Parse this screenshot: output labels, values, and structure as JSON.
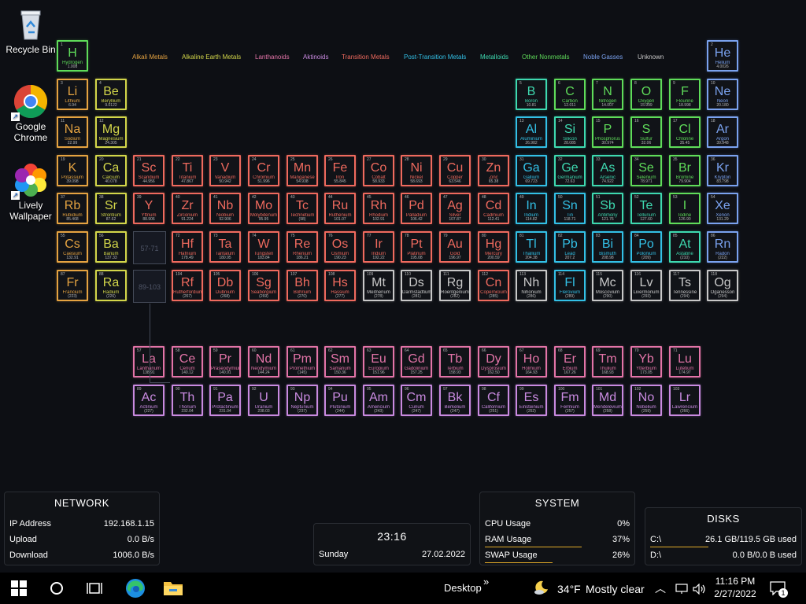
{
  "desktop": {
    "icons": [
      {
        "label": "Recycle Bin",
        "icon": "recycle-bin-icon"
      },
      {
        "label": "Google Chrome",
        "icon": "chrome-icon"
      },
      {
        "label": "Lively Wallpaper",
        "icon": "lively-wallpaper-icon"
      }
    ]
  },
  "legend": [
    {
      "label": "Alkali Metals",
      "color": "#e5a341"
    },
    {
      "label": "Alkaline Earth Metals",
      "color": "#d3d64a"
    },
    {
      "label": "Lanthanoids",
      "color": "#e374a8"
    },
    {
      "label": "Aktinoids",
      "color": "#c98ae0"
    },
    {
      "label": "Transition Metals",
      "color": "#ef6a5e"
    },
    {
      "label": "Post-Transition Metals",
      "color": "#33c0e6"
    },
    {
      "label": "Metalloids",
      "color": "#3ed9b0"
    },
    {
      "label": "Other Nonmetals",
      "color": "#5fdc5a"
    },
    {
      "label": "Noble Gasses",
      "color": "#7aa2ef"
    },
    {
      "label": "Unknown",
      "color": "#c8c8c8"
    }
  ],
  "placeholders": {
    "lanthanoids": "57-71",
    "actinoids": "89-103"
  },
  "elements": [
    {
      "n": "1",
      "s": "H",
      "name": "Hydrogen",
      "m": "1.008",
      "c": "nonmetal"
    },
    {
      "n": "2",
      "s": "He",
      "name": "Helium",
      "m": "4.0026",
      "c": "noble"
    },
    {
      "n": "3",
      "s": "Li",
      "name": "Lithium",
      "m": "6.94",
      "c": "alkali"
    },
    {
      "n": "4",
      "s": "Be",
      "name": "Beryllium",
      "m": "9.0122",
      "c": "alkaline"
    },
    {
      "n": "5",
      "s": "B",
      "name": "Boron",
      "m": "10.81",
      "c": "metalloid"
    },
    {
      "n": "6",
      "s": "C",
      "name": "Carbon",
      "m": "12.011",
      "c": "nonmetal"
    },
    {
      "n": "7",
      "s": "N",
      "name": "Nitrogen",
      "m": "14.007",
      "c": "nonmetal"
    },
    {
      "n": "8",
      "s": "O",
      "name": "Oxygen",
      "m": "15.999",
      "c": "nonmetal"
    },
    {
      "n": "9",
      "s": "F",
      "name": "Flourine",
      "m": "18.998",
      "c": "nonmetal"
    },
    {
      "n": "10",
      "s": "Ne",
      "name": "Neon",
      "m": "20.180",
      "c": "noble"
    },
    {
      "n": "11",
      "s": "Na",
      "name": "Sodium",
      "m": "22.99",
      "c": "alkali"
    },
    {
      "n": "12",
      "s": "Mg",
      "name": "Magnesium",
      "m": "24.305",
      "c": "alkaline"
    },
    {
      "n": "13",
      "s": "Al",
      "name": "Aluminium",
      "m": "26.982",
      "c": "post"
    },
    {
      "n": "14",
      "s": "Si",
      "name": "Silicon",
      "m": "28.085",
      "c": "metalloid"
    },
    {
      "n": "15",
      "s": "P",
      "name": "Phosphorus",
      "m": "30.974",
      "c": "nonmetal"
    },
    {
      "n": "16",
      "s": "S",
      "name": "Sulfur",
      "m": "32.06",
      "c": "nonmetal"
    },
    {
      "n": "17",
      "s": "Cl",
      "name": "Chlorine",
      "m": "35.45",
      "c": "nonmetal"
    },
    {
      "n": "18",
      "s": "Ar",
      "name": "Argon",
      "m": "39.948",
      "c": "noble"
    },
    {
      "n": "19",
      "s": "K",
      "name": "Potassium",
      "m": "39.098",
      "c": "alkali"
    },
    {
      "n": "20",
      "s": "Ca",
      "name": "Calcium",
      "m": "40.078",
      "c": "alkaline"
    },
    {
      "n": "21",
      "s": "Sc",
      "name": "Scandium",
      "m": "44.956",
      "c": "transition"
    },
    {
      "n": "22",
      "s": "Ti",
      "name": "Titanium",
      "m": "47.867",
      "c": "transition"
    },
    {
      "n": "23",
      "s": "V",
      "name": "Vanadium",
      "m": "50.942",
      "c": "transition"
    },
    {
      "n": "24",
      "s": "Cr",
      "name": "Chromium",
      "m": "51.996",
      "c": "transition"
    },
    {
      "n": "25",
      "s": "Mn",
      "name": "Manganese",
      "m": "54.938",
      "c": "transition"
    },
    {
      "n": "26",
      "s": "Fe",
      "name": "Iron",
      "m": "55.845",
      "c": "transition"
    },
    {
      "n": "27",
      "s": "Co",
      "name": "Cobalt",
      "m": "58.933",
      "c": "transition"
    },
    {
      "n": "28",
      "s": "Ni",
      "name": "Nickel",
      "m": "58.693",
      "c": "transition"
    },
    {
      "n": "29",
      "s": "Cu",
      "name": "Copper",
      "m": "63.546",
      "c": "transition"
    },
    {
      "n": "30",
      "s": "Zn",
      "name": "Zinc",
      "m": "65.38",
      "c": "transition"
    },
    {
      "n": "31",
      "s": "Ga",
      "name": "Gallium",
      "m": "69.723",
      "c": "post"
    },
    {
      "n": "32",
      "s": "Ge",
      "name": "Germanium",
      "m": "72.63",
      "c": "metalloid"
    },
    {
      "n": "33",
      "s": "As",
      "name": "Arsenic",
      "m": "74.922",
      "c": "metalloid"
    },
    {
      "n": "34",
      "s": "Se",
      "name": "Selenium",
      "m": "78.971",
      "c": "nonmetal"
    },
    {
      "n": "35",
      "s": "Br",
      "name": "Bromine",
      "m": "79.904",
      "c": "nonmetal"
    },
    {
      "n": "36",
      "s": "Kr",
      "name": "Krypton",
      "m": "83.798",
      "c": "noble"
    },
    {
      "n": "37",
      "s": "Rb",
      "name": "Rubidium",
      "m": "85.468",
      "c": "alkali"
    },
    {
      "n": "38",
      "s": "Sr",
      "name": "Strontium",
      "m": "87.62",
      "c": "alkaline"
    },
    {
      "n": "39",
      "s": "Y",
      "name": "Yttrium",
      "m": "88.906",
      "c": "transition"
    },
    {
      "n": "40",
      "s": "Zr",
      "name": "Zirconium",
      "m": "91.224",
      "c": "transition"
    },
    {
      "n": "41",
      "s": "Nb",
      "name": "Niobium",
      "m": "92.906",
      "c": "transition"
    },
    {
      "n": "42",
      "s": "Mo",
      "name": "Molybdenum",
      "m": "95.95",
      "c": "transition"
    },
    {
      "n": "43",
      "s": "Tc",
      "name": "Technetium",
      "m": "(98)",
      "c": "transition"
    },
    {
      "n": "44",
      "s": "Ru",
      "name": "Ruthenium",
      "m": "101.07",
      "c": "transition"
    },
    {
      "n": "45",
      "s": "Rh",
      "name": "Rhodium",
      "m": "102.91",
      "c": "transition"
    },
    {
      "n": "46",
      "s": "Pd",
      "name": "Palladium",
      "m": "106.42",
      "c": "transition"
    },
    {
      "n": "47",
      "s": "Ag",
      "name": "Silver",
      "m": "107.87",
      "c": "transition"
    },
    {
      "n": "48",
      "s": "Cd",
      "name": "Cadmium",
      "m": "112.41",
      "c": "transition"
    },
    {
      "n": "49",
      "s": "In",
      "name": "Indium",
      "m": "114.82",
      "c": "post"
    },
    {
      "n": "50",
      "s": "Sn",
      "name": "Tin",
      "m": "118.71",
      "c": "post"
    },
    {
      "n": "51",
      "s": "Sb",
      "name": "Antimony",
      "m": "121.76",
      "c": "metalloid"
    },
    {
      "n": "52",
      "s": "Te",
      "name": "Tellurium",
      "m": "127.60",
      "c": "metalloid"
    },
    {
      "n": "53",
      "s": "I",
      "name": "Iodine",
      "m": "126.90",
      "c": "nonmetal"
    },
    {
      "n": "54",
      "s": "Xe",
      "name": "Xenon",
      "m": "131.29",
      "c": "noble"
    },
    {
      "n": "55",
      "s": "Cs",
      "name": "Caesium",
      "m": "132.91",
      "c": "alkali"
    },
    {
      "n": "56",
      "s": "Ba",
      "name": "Barium",
      "m": "137.33",
      "c": "alkaline"
    },
    {
      "n": "72",
      "s": "Hf",
      "name": "Hafnium",
      "m": "178.49",
      "c": "transition"
    },
    {
      "n": "73",
      "s": "Ta",
      "name": "Tantalum",
      "m": "180.95",
      "c": "transition"
    },
    {
      "n": "74",
      "s": "W",
      "name": "Tungsten",
      "m": "183.84",
      "c": "transition"
    },
    {
      "n": "75",
      "s": "Re",
      "name": "Rhenium",
      "m": "186.21",
      "c": "transition"
    },
    {
      "n": "76",
      "s": "Os",
      "name": "Osmium",
      "m": "190.23",
      "c": "transition"
    },
    {
      "n": "77",
      "s": "Ir",
      "name": "Iridium",
      "m": "192.22",
      "c": "transition"
    },
    {
      "n": "78",
      "s": "Pt",
      "name": "Platinum",
      "m": "195.08",
      "c": "transition"
    },
    {
      "n": "79",
      "s": "Au",
      "name": "Gold",
      "m": "196.97",
      "c": "transition"
    },
    {
      "n": "80",
      "s": "Hg",
      "name": "Mercury",
      "m": "200.59",
      "c": "transition"
    },
    {
      "n": "81",
      "s": "Tl",
      "name": "Thallium",
      "m": "204.38",
      "c": "post"
    },
    {
      "n": "82",
      "s": "Pb",
      "name": "Lead",
      "m": "207.2",
      "c": "post"
    },
    {
      "n": "83",
      "s": "Bi",
      "name": "Bismuth",
      "m": "208.98",
      "c": "post"
    },
    {
      "n": "84",
      "s": "Po",
      "name": "Polonium",
      "m": "(209)",
      "c": "post"
    },
    {
      "n": "85",
      "s": "At",
      "name": "Astatine",
      "m": "(210)",
      "c": "metalloid"
    },
    {
      "n": "86",
      "s": "Rn",
      "name": "Radon",
      "m": "(222)",
      "c": "noble"
    },
    {
      "n": "87",
      "s": "Fr",
      "name": "Francium",
      "m": "(223)",
      "c": "alkali"
    },
    {
      "n": "88",
      "s": "Ra",
      "name": "Radium",
      "m": "(226)",
      "c": "alkaline"
    },
    {
      "n": "104",
      "s": "Rf",
      "name": "Rutherfordium",
      "m": "(267)",
      "c": "transition"
    },
    {
      "n": "105",
      "s": "Db",
      "name": "Dubnium",
      "m": "(268)",
      "c": "transition"
    },
    {
      "n": "106",
      "s": "Sg",
      "name": "Seaborgium",
      "m": "(269)",
      "c": "transition"
    },
    {
      "n": "107",
      "s": "Bh",
      "name": "Bohrium",
      "m": "(270)",
      "c": "transition"
    },
    {
      "n": "108",
      "s": "Hs",
      "name": "Hassium",
      "m": "(277)",
      "c": "transition"
    },
    {
      "n": "109",
      "s": "Mt",
      "name": "Meitnerium",
      "m": "(278)",
      "c": "unknown"
    },
    {
      "n": "110",
      "s": "Ds",
      "name": "Darmstadtium",
      "m": "(281)",
      "c": "unknown"
    },
    {
      "n": "111",
      "s": "Rg",
      "name": "Roentgenium",
      "m": "(282)",
      "c": "unknown"
    },
    {
      "n": "112",
      "s": "Cn",
      "name": "Copernicium",
      "m": "(285)",
      "c": "transition"
    },
    {
      "n": "113",
      "s": "Nh",
      "name": "Nihonium",
      "m": "(286)",
      "c": "unknown"
    },
    {
      "n": "114",
      "s": "Fl",
      "name": "Flerovium",
      "m": "(289)",
      "c": "post"
    },
    {
      "n": "115",
      "s": "Mc",
      "name": "Moscovium",
      "m": "(290)",
      "c": "unknown"
    },
    {
      "n": "116",
      "s": "Lv",
      "name": "Livermorium",
      "m": "(293)",
      "c": "unknown"
    },
    {
      "n": "117",
      "s": "Ts",
      "name": "Tennessine",
      "m": "(294)",
      "c": "unknown"
    },
    {
      "n": "118",
      "s": "Og",
      "name": "Oganesson",
      "m": "(294)",
      "c": "unknown"
    },
    {
      "n": "57",
      "s": "La",
      "name": "Lanthanum",
      "m": "138.91",
      "c": "lanthanoid"
    },
    {
      "n": "58",
      "s": "Ce",
      "name": "Cerium",
      "m": "140.12",
      "c": "lanthanoid"
    },
    {
      "n": "59",
      "s": "Pr",
      "name": "Praseodymium",
      "m": "140.91",
      "c": "lanthanoid"
    },
    {
      "n": "60",
      "s": "Nd",
      "name": "Neodymium",
      "m": "144.24",
      "c": "lanthanoid"
    },
    {
      "n": "61",
      "s": "Pm",
      "name": "Promethium",
      "m": "(145)",
      "c": "lanthanoid"
    },
    {
      "n": "62",
      "s": "Sm",
      "name": "Samarium",
      "m": "150.36",
      "c": "lanthanoid"
    },
    {
      "n": "63",
      "s": "Eu",
      "name": "Europium",
      "m": "151.96",
      "c": "lanthanoid"
    },
    {
      "n": "64",
      "s": "Gd",
      "name": "Gadolinium",
      "m": "157.25",
      "c": "lanthanoid"
    },
    {
      "n": "65",
      "s": "Tb",
      "name": "Terbium",
      "m": "158.93",
      "c": "lanthanoid"
    },
    {
      "n": "66",
      "s": "Dy",
      "name": "Dysprosium",
      "m": "162.50",
      "c": "lanthanoid"
    },
    {
      "n": "67",
      "s": "Ho",
      "name": "Holmium",
      "m": "164.93",
      "c": "lanthanoid"
    },
    {
      "n": "68",
      "s": "Er",
      "name": "Erbium",
      "m": "167.26",
      "c": "lanthanoid"
    },
    {
      "n": "69",
      "s": "Tm",
      "name": "Thulium",
      "m": "168.93",
      "c": "lanthanoid"
    },
    {
      "n": "70",
      "s": "Yb",
      "name": "Ytterbium",
      "m": "173.05",
      "c": "lanthanoid"
    },
    {
      "n": "71",
      "s": "Lu",
      "name": "Lutetium",
      "m": "174.97",
      "c": "lanthanoid"
    },
    {
      "n": "89",
      "s": "Ac",
      "name": "Actinium",
      "m": "(227)",
      "c": "actinoid"
    },
    {
      "n": "90",
      "s": "Th",
      "name": "Thorium",
      "m": "232.04",
      "c": "actinoid"
    },
    {
      "n": "91",
      "s": "Pa",
      "name": "Protactinium",
      "m": "231.04",
      "c": "actinoid"
    },
    {
      "n": "92",
      "s": "U",
      "name": "Uranium",
      "m": "238.03",
      "c": "actinoid"
    },
    {
      "n": "93",
      "s": "Np",
      "name": "Neptunium",
      "m": "(237)",
      "c": "actinoid"
    },
    {
      "n": "94",
      "s": "Pu",
      "name": "Plutonium",
      "m": "(244)",
      "c": "actinoid"
    },
    {
      "n": "95",
      "s": "Am",
      "name": "Americium",
      "m": "(243)",
      "c": "actinoid"
    },
    {
      "n": "96",
      "s": "Cm",
      "name": "Curium",
      "m": "(247)",
      "c": "actinoid"
    },
    {
      "n": "97",
      "s": "Bk",
      "name": "Berkelium",
      "m": "(247)",
      "c": "actinoid"
    },
    {
      "n": "98",
      "s": "Cf",
      "name": "Californium",
      "m": "(251)",
      "c": "actinoid"
    },
    {
      "n": "99",
      "s": "Es",
      "name": "Einsteinium",
      "m": "(252)",
      "c": "actinoid"
    },
    {
      "n": "100",
      "s": "Fm",
      "name": "Fermium",
      "m": "(257)",
      "c": "actinoid"
    },
    {
      "n": "101",
      "s": "Md",
      "name": "Mendelevium",
      "m": "(258)",
      "c": "actinoid"
    },
    {
      "n": "102",
      "s": "No",
      "name": "Nobelium",
      "m": "(259)",
      "c": "actinoid"
    },
    {
      "n": "103",
      "s": "Lr",
      "name": "Lawrencium",
      "m": "(266)",
      "c": "actinoid"
    }
  ],
  "category_colors": {
    "alkali": "#e5a341",
    "alkaline": "#d3d64a",
    "lanthanoid": "#e374a8",
    "actinoid": "#c98ae0",
    "transition": "#ef6a5e",
    "post": "#33c0e6",
    "metalloid": "#3ed9b0",
    "nonmetal": "#5fdc5a",
    "noble": "#7aa2ef",
    "unknown": "#c8c8c8"
  },
  "network": {
    "title": "NETWORK",
    "rows": [
      {
        "label": "IP Address",
        "value": "192.168.1.15"
      },
      {
        "label": "Upload",
        "value": "0.0 B/s"
      },
      {
        "label": "Download",
        "value": "1006.0 B/s"
      }
    ]
  },
  "clock": {
    "time": "23:16",
    "day": "Sunday",
    "date": "27.02.2022"
  },
  "system": {
    "title": "SYSTEM",
    "rows": [
      {
        "label": "CPU Usage",
        "value": "0%",
        "level": 0
      },
      {
        "label": "RAM Usage",
        "value": "37%",
        "level": 0.37
      },
      {
        "label": "SWAP Usage",
        "value": "26%",
        "level": 0.26
      }
    ]
  },
  "disks": {
    "title": "DISKS",
    "rows": [
      {
        "label": "C:\\",
        "value": "26.1 GB/119.5 GB used",
        "level": 0.22
      },
      {
        "label": "D:\\",
        "value": "0.0 B/0.0 B used",
        "level": 0
      }
    ]
  },
  "taskbar": {
    "desktop_label": "Desktop",
    "chevron": "»",
    "weather_temp": "34°F",
    "weather_text": "Mostly clear",
    "time": "11:16 PM",
    "date": "2/27/2022",
    "notification_count": "1"
  }
}
